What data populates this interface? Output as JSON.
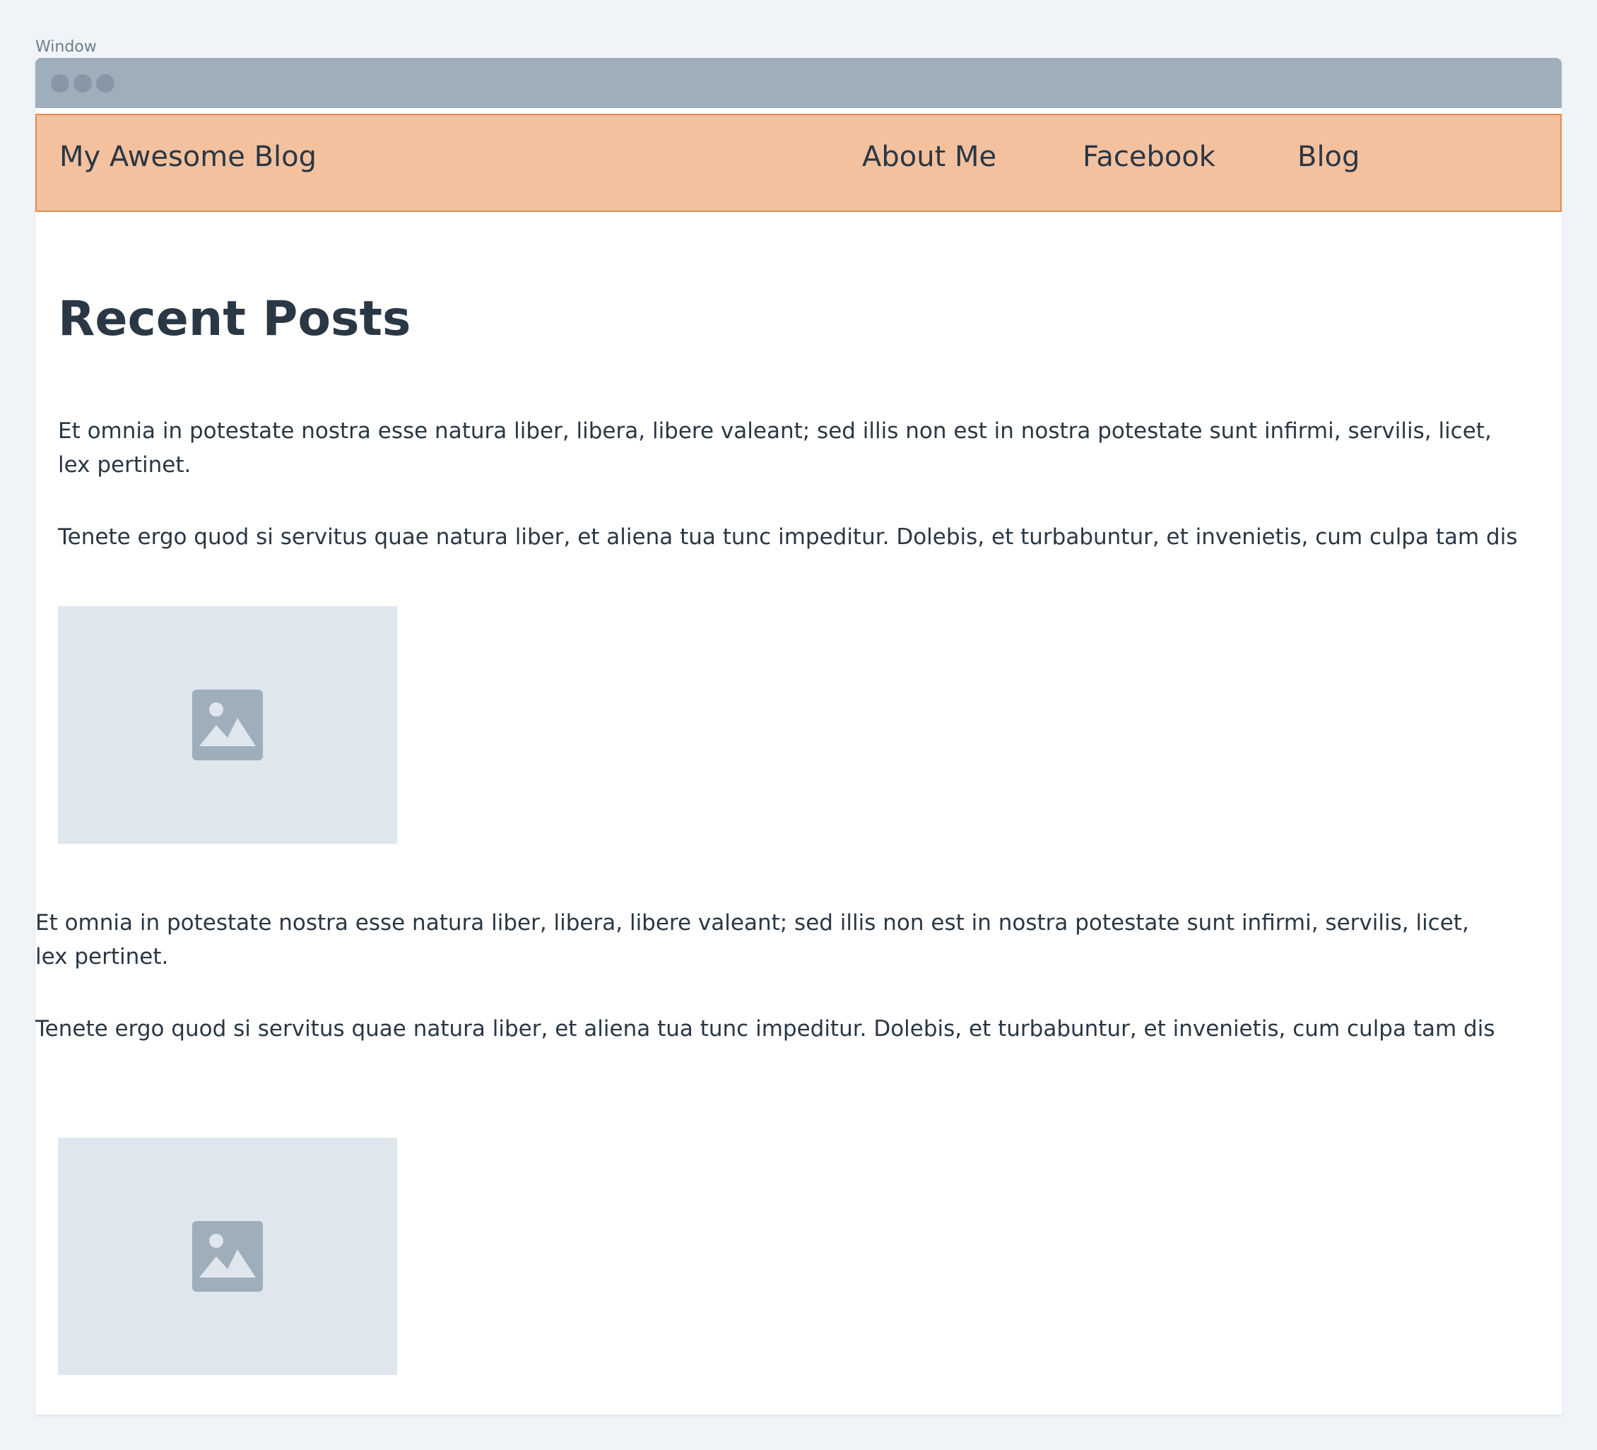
{
  "window": {
    "caption": "Window"
  },
  "navbar": {
    "brand": "My Awesome Blog",
    "links": [
      "About Me",
      "Facebook",
      "Blog"
    ]
  },
  "main": {
    "heading": "Recent Posts",
    "posts": [
      {
        "paragraphs": [
          "Et omnia in potestate nostra esse natura liber, libera, libere valeant; sed illis non est in nostra potestate sunt infirmi, servilis, licet, lex pertinet.",
          "Tenete ergo quod si servitus quae natura liber, et aliena tua tunc impeditur. Dolebis, et turbabuntur, et invenietis, cum culpa tam dis"
        ],
        "image_icon": "image-placeholder-icon"
      },
      {
        "paragraphs": [
          "Et omnia in potestate nostra esse natura liber, libera, libere valeant; sed illis non est in nostra potestate sunt infirmi, servilis, licet, lex pertinet.",
          "Tenete ergo quod si servitus quae natura liber, et aliena tua tunc impeditur. Dolebis, et turbabuntur, et invenietis, cum culpa tam dis"
        ],
        "image_icon": "image-placeholder-icon"
      }
    ]
  },
  "colors": {
    "page_background": "#f0f4f8",
    "titlebar": "#9eaebb",
    "navbar_fill": "#f4c19f",
    "navbar_border": "#e58a4e",
    "text": "#2a3744",
    "image_placeholder": "#dfe6ee"
  }
}
